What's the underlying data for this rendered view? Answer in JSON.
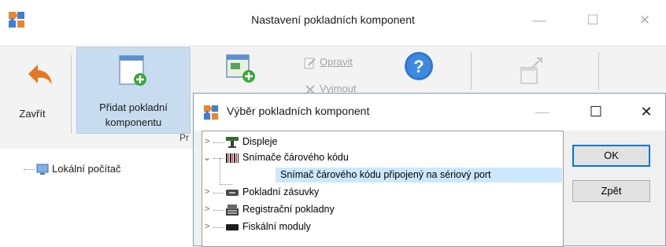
{
  "window": {
    "title": "Nastavení pokladních komponent",
    "minimize_glyph": "—",
    "maximize_glyph": "☐",
    "close_glyph": "✕",
    "app_icon": "puzzle-icon"
  },
  "ribbon": {
    "close_label": "Zavřít",
    "add_label_1": "Přidat pokladní",
    "add_label_2": "komponentu",
    "edit_label": "Opravit",
    "remove_label": "Vyjmout",
    "group_label": "Pr",
    "icons": {
      "close": "back-arrow-icon",
      "add": "add-component-icon",
      "add2": "add-window-icon",
      "edit": "edit-icon",
      "remove": "remove-icon",
      "help": "help-icon",
      "export": "export-icon"
    }
  },
  "left_tree": {
    "root_label": "Lokální počítač",
    "root_icon": "computer-icon"
  },
  "dialog": {
    "title": "Výběr pokladních komponent",
    "minimize_glyph": "—",
    "maximize_glyph": "☐",
    "close_glyph": "✕",
    "ok_label": "OK",
    "back_label": "Zpět",
    "tree": [
      {
        "label": "Displeje",
        "expanded": false,
        "icon": "display-icon"
      },
      {
        "label": "Snímače čárového kódu",
        "expanded": true,
        "icon": "barcode-icon"
      },
      {
        "label": "Snímač čárového kódu připojený na sériový port",
        "child": true,
        "selected": true
      },
      {
        "label": "Pokladní zásuvky",
        "expanded": false,
        "icon": "drawer-icon"
      },
      {
        "label": "Registrační pokladny",
        "expanded": false,
        "icon": "register-icon"
      },
      {
        "label": "Fiskální moduly",
        "expanded": false,
        "icon": "fiscal-module-icon"
      }
    ]
  },
  "colors": {
    "accent": "#0078d7",
    "ribbon_selected": "#c7dcef",
    "tree_selected": "#cce8ff"
  }
}
